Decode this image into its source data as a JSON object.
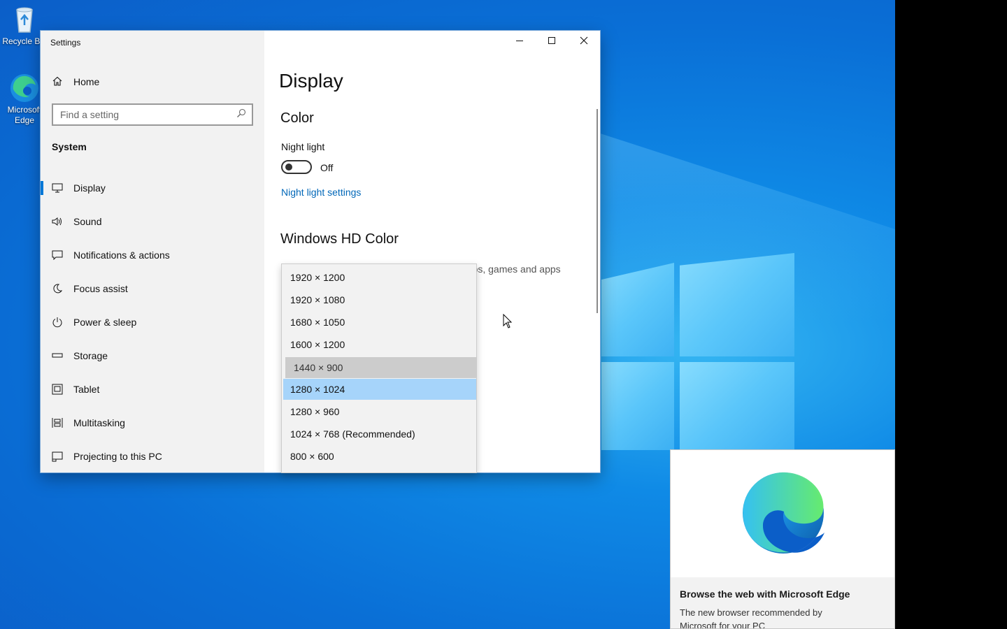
{
  "desktop": {
    "icons": [
      {
        "label": "Recycle Bin"
      },
      {
        "label": "Microsoft Edge"
      }
    ]
  },
  "settings": {
    "window_title": "Settings",
    "sidebar": {
      "home_label": "Home",
      "search_placeholder": "Find a setting",
      "section_label": "System",
      "items": [
        {
          "label": "Display",
          "icon": "monitor-icon",
          "active": true
        },
        {
          "label": "Sound",
          "icon": "speaker-icon"
        },
        {
          "label": "Notifications & actions",
          "icon": "notification-icon"
        },
        {
          "label": "Focus assist",
          "icon": "moon-icon"
        },
        {
          "label": "Power & sleep",
          "icon": "power-icon"
        },
        {
          "label": "Storage",
          "icon": "storage-icon"
        },
        {
          "label": "Tablet",
          "icon": "tablet-icon"
        },
        {
          "label": "Multitasking",
          "icon": "multitasking-icon"
        },
        {
          "label": "Projecting to this PC",
          "icon": "projecting-icon"
        }
      ]
    },
    "content": {
      "page_title": "Display",
      "color_heading": "Color",
      "night_light_label": "Night light",
      "night_light_state": "Off",
      "night_light_link": "Night light settings",
      "hdr_heading": "Windows HD Color",
      "hdr_description_visible": "deos, games and apps"
    },
    "resolution_dropdown": {
      "options": [
        "1920 × 1200",
        "1920 × 1080",
        "1680 × 1050",
        "1600 × 1200",
        "1440 × 900",
        "1280 × 1024",
        "1280 × 960",
        "1024 × 768 (Recommended)",
        "800 × 600"
      ],
      "hovered_option": "1440 × 900",
      "selected_option": "1280 × 1024"
    }
  },
  "toast": {
    "title": "Browse the web with Microsoft Edge",
    "body": "The new browser recommended by Microsoft for your PC"
  },
  "colors": {
    "accent": "#0078d7",
    "link": "#0067b8",
    "selected_option_bg": "#a6d4fa",
    "hovered_option_bg": "#cccccc",
    "desktop_blue": "#0a6fd6"
  }
}
